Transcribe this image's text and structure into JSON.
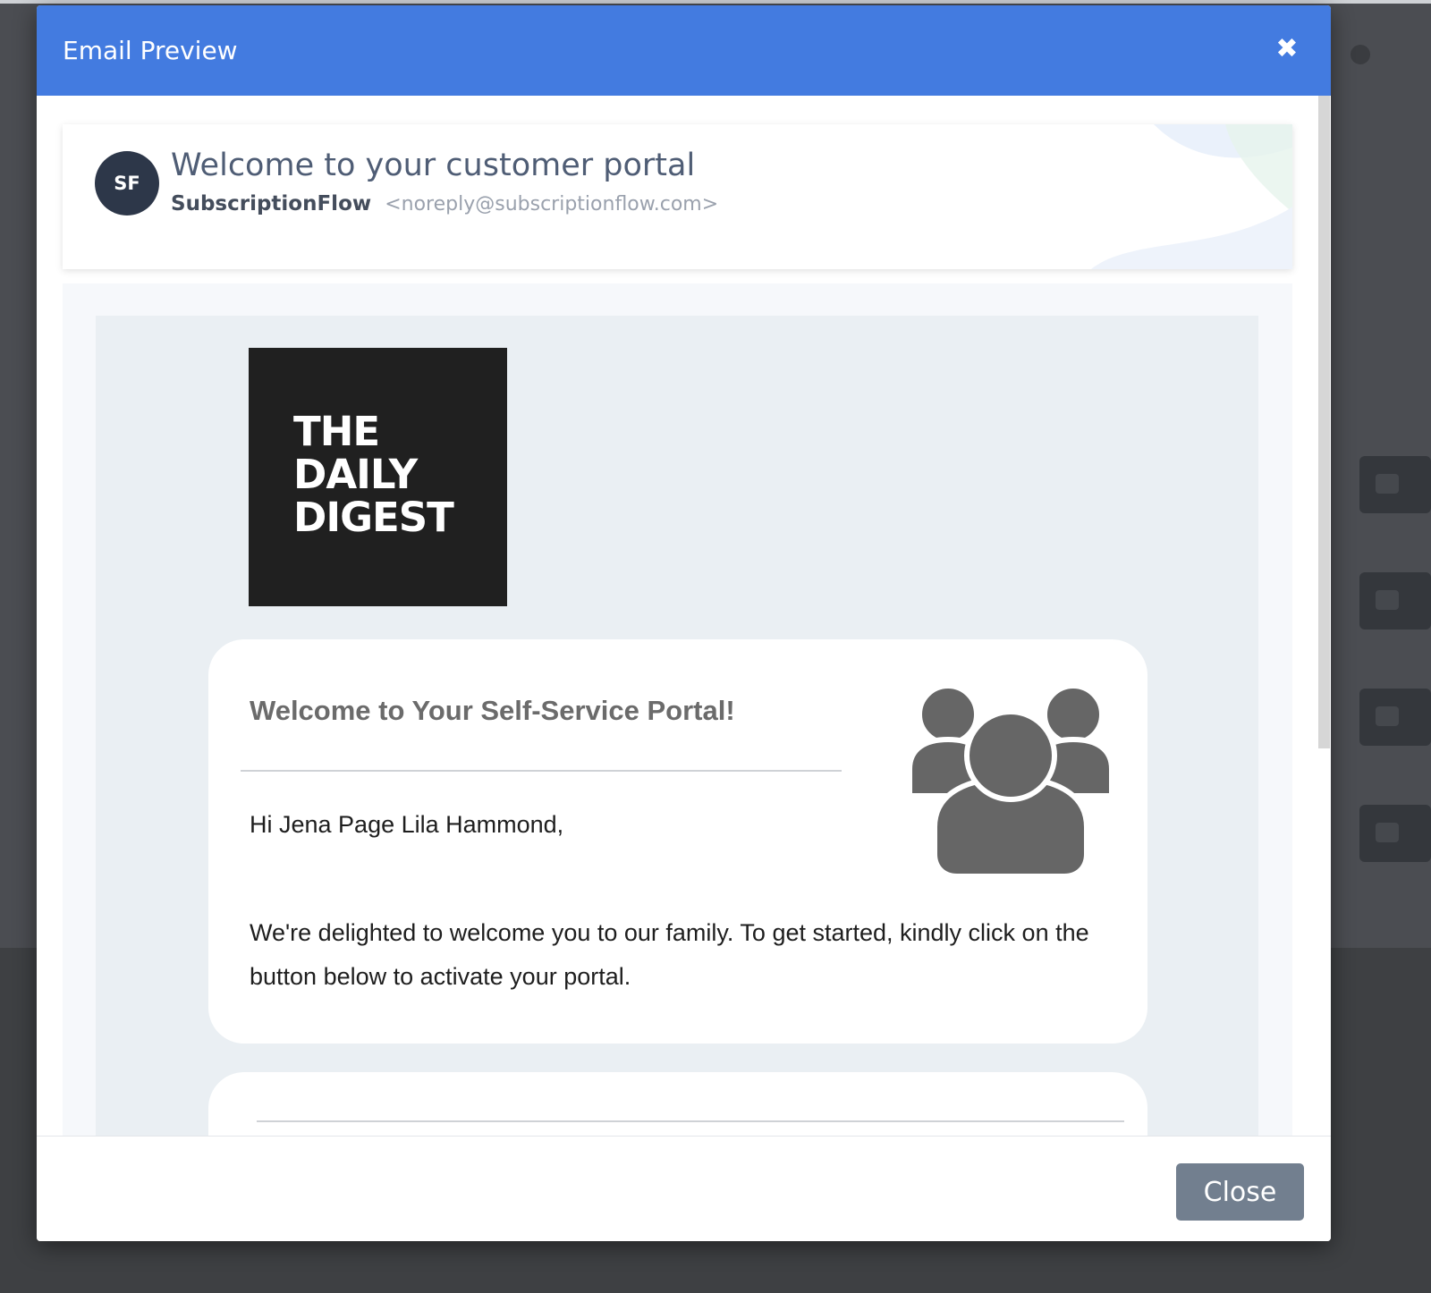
{
  "modal": {
    "title": "Email Preview",
    "close_icon": "times-icon"
  },
  "sender": {
    "avatar_initials": "SF",
    "subject": "Welcome to your customer portal",
    "name": "SubscriptionFlow",
    "email": "<noreply@subscriptionflow.com>"
  },
  "email": {
    "logo_lines": [
      "THE",
      "DAILY",
      "DIGEST"
    ],
    "heading": "Welcome to Your Self-Service Portal!",
    "greeting": "Hi Jena Page Lila Hammond,",
    "body": "We're delighted to welcome you to our family. To get started, kindly click on the button below to activate your portal.",
    "illustration_icon": "users-icon"
  },
  "footer": {
    "close_label": "Close"
  },
  "colors": {
    "header": "#437be0",
    "avatar": "#2d3749",
    "close_button": "#727f8f",
    "logo_bg": "#202020",
    "email_canvas": "#eaeff3"
  }
}
